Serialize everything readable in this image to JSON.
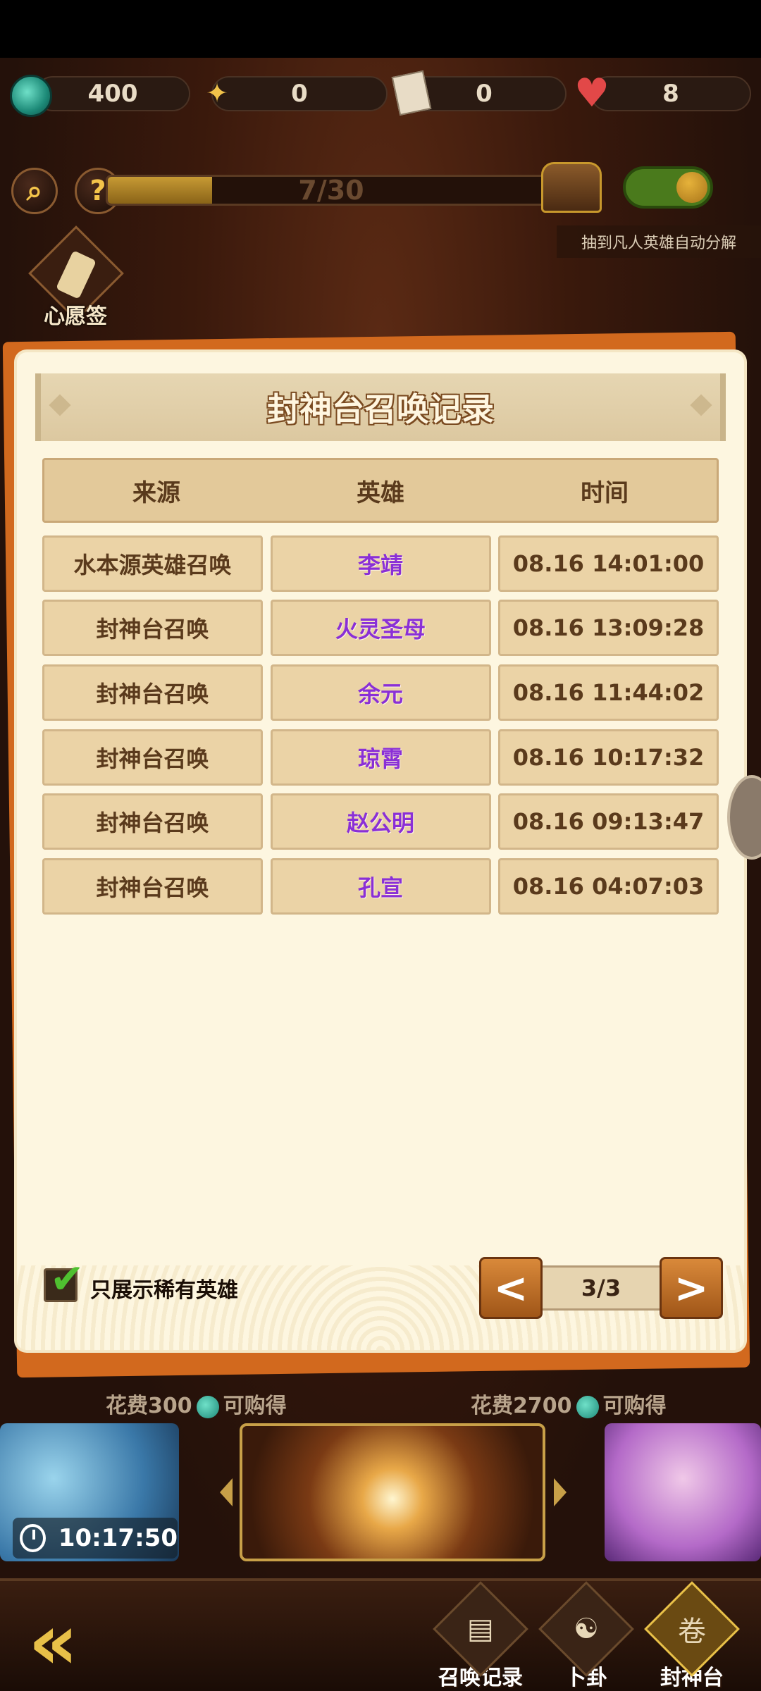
{
  "resources": [
    {
      "icon": "jade-currency-icon",
      "value": "400"
    },
    {
      "icon": "hero-token-icon",
      "value": "0"
    },
    {
      "icon": "scroll-ticket-icon",
      "value": "0"
    },
    {
      "icon": "heart-icon",
      "value": "8"
    }
  ],
  "progress": {
    "text": "7/30",
    "fraction": 0.233
  },
  "auto_decompose_label": "抽到凡人英雄自动分解",
  "wish_label": "心愿签",
  "modal": {
    "title": "封神台召唤记录",
    "columns": [
      "来源",
      "英雄",
      "时间"
    ],
    "rows": [
      {
        "source": "水本源英雄召唤",
        "hero": "李靖",
        "time": "08.16 14:01:00"
      },
      {
        "source": "封神台召唤",
        "hero": "火灵圣母",
        "time": "08.16 13:09:28"
      },
      {
        "source": "封神台召唤",
        "hero": "余元",
        "time": "08.16 11:44:02"
      },
      {
        "source": "封神台召唤",
        "hero": "琼霄",
        "time": "08.16 10:17:32"
      },
      {
        "source": "封神台召唤",
        "hero": "赵公明",
        "time": "08.16 09:13:47"
      },
      {
        "source": "封神台召唤",
        "hero": "孔宣",
        "time": "08.16 04:07:03"
      }
    ],
    "filter_label": "只展示稀有英雄",
    "page_indicator": "3/3",
    "prev_label": "<",
    "next_label": ">"
  },
  "costs": {
    "left": {
      "prefix": "花费300",
      "suffix": "可购得"
    },
    "right": {
      "prefix": "花费2700",
      "suffix": "可购得"
    }
  },
  "timer": "10:17:50",
  "nav": {
    "summon_record": "召唤记录",
    "divination": "卜卦",
    "fengshen": "封神台"
  },
  "colors": {
    "hero_name": "#8a2fd6",
    "accent_orange": "#d2691e",
    "parchment": "#fdf6e0",
    "check_green": "#4fc030"
  }
}
